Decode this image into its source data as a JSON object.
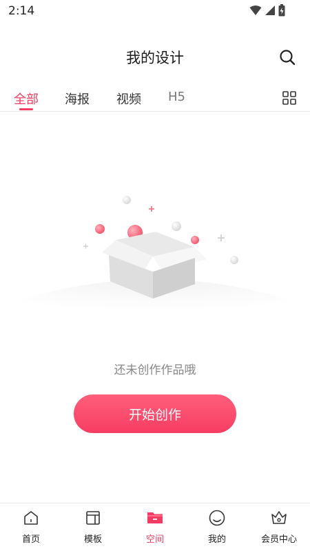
{
  "status_bar": {
    "time": "2:14"
  },
  "header": {
    "title": "我的设计",
    "search_icon": "search-icon"
  },
  "tabs": [
    {
      "label": "全部",
      "active": true
    },
    {
      "label": "海报",
      "active": false
    },
    {
      "label": "视频",
      "active": false
    },
    {
      "label": "H5",
      "active": false
    }
  ],
  "empty_state": {
    "message": "还未创作作品哦",
    "illustration": "empty-box-icon"
  },
  "start_button": {
    "label": "开始创作"
  },
  "bottom_nav": [
    {
      "label": "首页",
      "icon": "home-icon",
      "active": false
    },
    {
      "label": "模板",
      "icon": "template-icon",
      "active": false
    },
    {
      "label": "空间",
      "icon": "folder-icon",
      "active": true
    },
    {
      "label": "我的",
      "icon": "profile-icon",
      "active": false
    },
    {
      "label": "会员中心",
      "icon": "vip-crown-icon",
      "active": false
    }
  ],
  "colors": {
    "accent": "#f43b62",
    "text": "#222222",
    "muted": "#888888",
    "divider": "#e6e6e6"
  }
}
